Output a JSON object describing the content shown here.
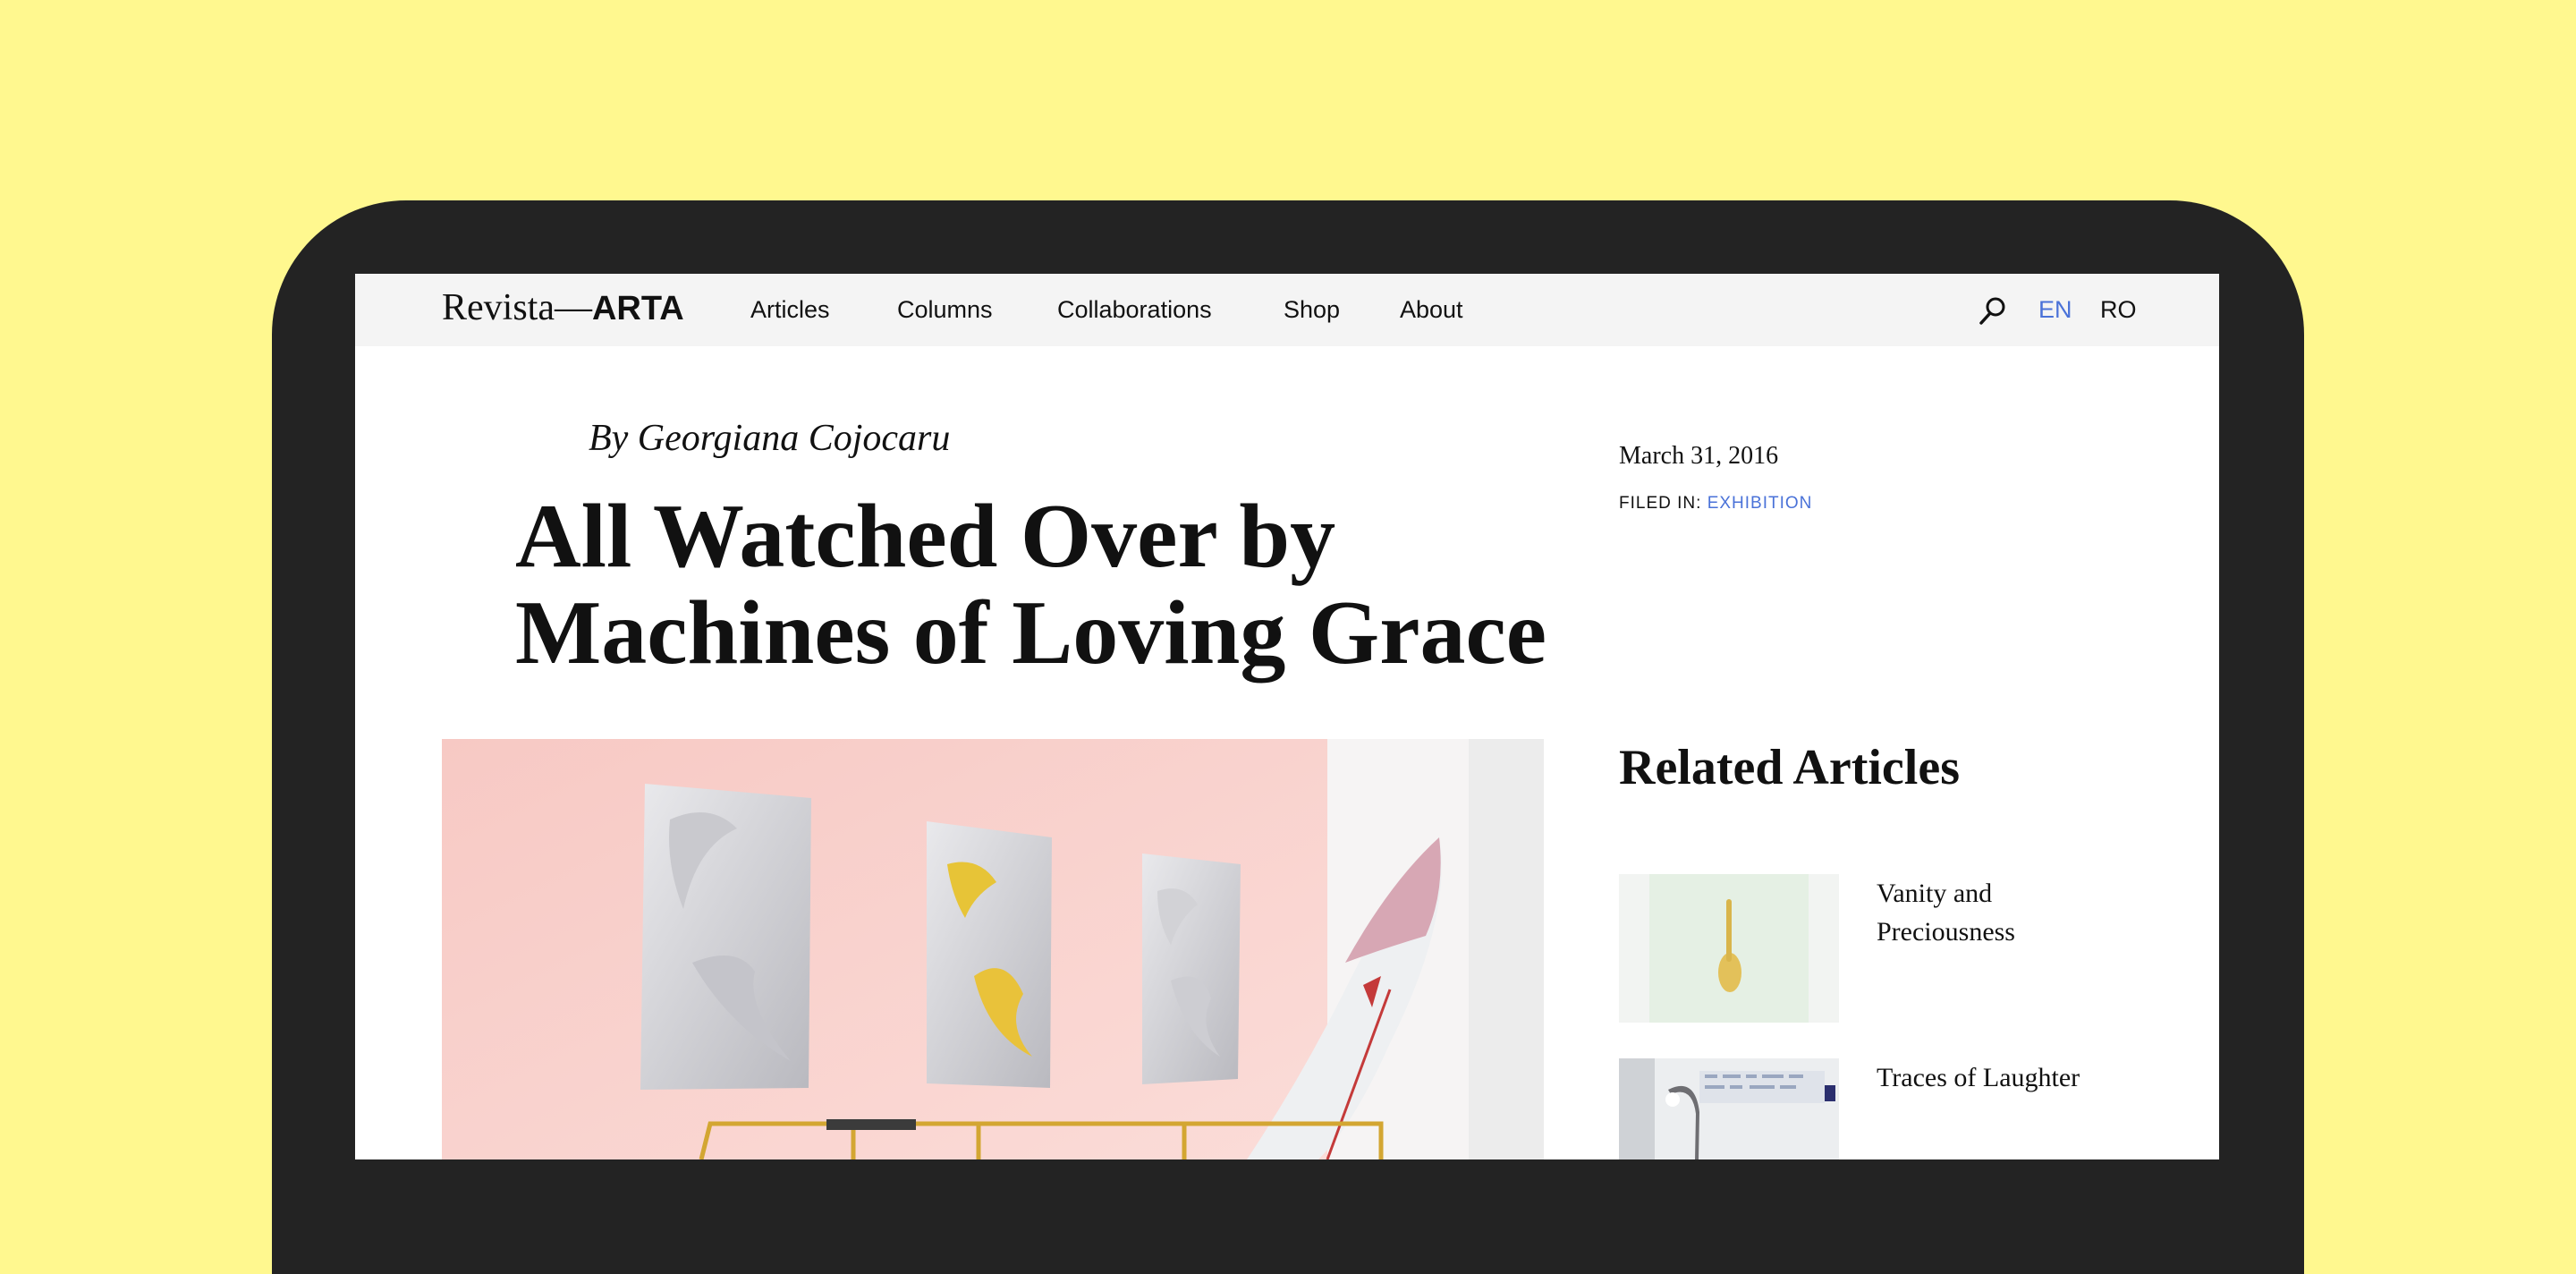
{
  "site": {
    "logo_light": "Revista—",
    "logo_bold": "ARTA"
  },
  "nav": {
    "links": [
      "Articles",
      "Columns",
      "Collaborations",
      "Shop",
      "About"
    ],
    "languages": [
      "EN",
      "RO"
    ],
    "active_language": "EN",
    "search_icon": "search-icon"
  },
  "article": {
    "byline": "By Georgiana Cojocaru",
    "title": "All Watched Over by Machines of Loving Grace",
    "date": "March 31, 2016",
    "filed_label": "FILED IN:",
    "category": "EXHIBITION"
  },
  "related": {
    "heading": "Related Articles",
    "items": [
      {
        "title": "Vanity and Preciousness"
      },
      {
        "title": "Traces of Laughter"
      }
    ]
  },
  "colors": {
    "background": "#fff88f",
    "device": "#232323",
    "nav_bg": "#f4f4f4",
    "accent_link": "#4a72d8"
  }
}
